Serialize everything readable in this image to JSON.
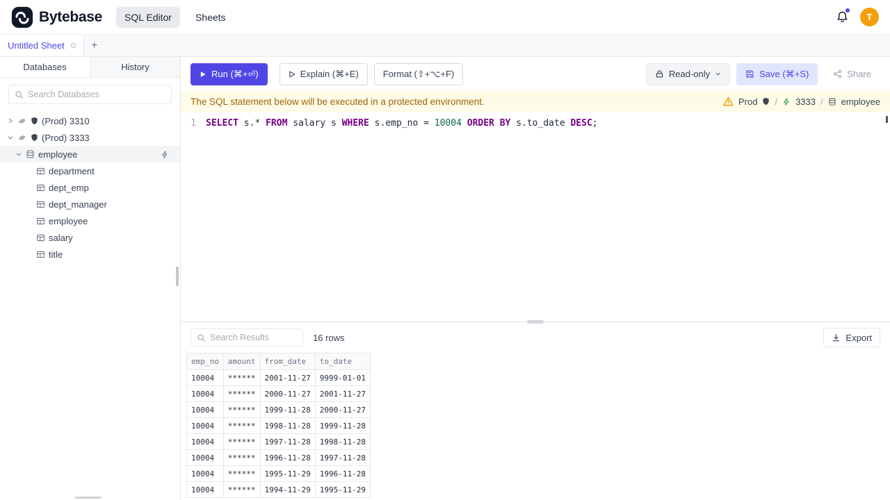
{
  "topbar": {
    "brand": "Bytebase",
    "nav": [
      {
        "label": "SQL Editor",
        "active": true
      },
      {
        "label": "Sheets",
        "active": false
      }
    ],
    "avatar_initial": "T"
  },
  "tabstrip": {
    "tabs": [
      {
        "label": "Untitled Sheet",
        "unsaved": true
      }
    ],
    "add_label": "+"
  },
  "sidebar": {
    "tabs": [
      {
        "label": "Databases",
        "active": true
      },
      {
        "label": "History",
        "active": false
      }
    ],
    "search_placeholder": "Search Databases",
    "tree": [
      {
        "label": "(Prod) 3310",
        "type": "instance",
        "depth": 0,
        "expanded": false,
        "selected": false
      },
      {
        "label": "(Prod) 3333",
        "type": "instance",
        "depth": 0,
        "expanded": true,
        "selected": false
      },
      {
        "label": "employee",
        "type": "database",
        "depth": 1,
        "expanded": true,
        "selected": true
      },
      {
        "label": "department",
        "type": "table",
        "depth": 2
      },
      {
        "label": "dept_emp",
        "type": "table",
        "depth": 2
      },
      {
        "label": "dept_manager",
        "type": "table",
        "depth": 2
      },
      {
        "label": "employee",
        "type": "table",
        "depth": 2
      },
      {
        "label": "salary",
        "type": "table",
        "depth": 2
      },
      {
        "label": "title",
        "type": "table",
        "depth": 2
      }
    ]
  },
  "toolbar": {
    "run_label": "Run (⌘+⏎)",
    "explain_label": "Explain (⌘+E)",
    "format_label": "Format (⇧+⌥+F)",
    "readonly_label": "Read-only",
    "save_label": "Save (⌘+S)",
    "share_label": "Share"
  },
  "banner": {
    "message": "The SQL statement below will be executed in a protected environment.",
    "environment": "Prod",
    "instance": "3333",
    "database": "employee",
    "separator": "/"
  },
  "editor": {
    "line_number": "1",
    "tokens": [
      {
        "text": "SELECT",
        "type": "keyword"
      },
      {
        "text": " s.",
        "type": "plain"
      },
      {
        "text": "*",
        "type": "operator"
      },
      {
        "text": " ",
        "type": "plain"
      },
      {
        "text": "FROM",
        "type": "keyword"
      },
      {
        "text": " salary s ",
        "type": "plain"
      },
      {
        "text": "WHERE",
        "type": "keyword"
      },
      {
        "text": " s.emp_no ",
        "type": "plain"
      },
      {
        "text": "=",
        "type": "operator"
      },
      {
        "text": " ",
        "type": "plain"
      },
      {
        "text": "10004",
        "type": "number"
      },
      {
        "text": " ",
        "type": "plain"
      },
      {
        "text": "ORDER",
        "type": "keyword"
      },
      {
        "text": " ",
        "type": "plain"
      },
      {
        "text": "BY",
        "type": "keyword"
      },
      {
        "text": " s.to_date ",
        "type": "plain"
      },
      {
        "text": "DESC",
        "type": "keyword"
      },
      {
        "text": ";",
        "type": "plain"
      }
    ]
  },
  "results": {
    "search_placeholder": "Search Results",
    "row_count": "16 rows",
    "export_label": "Export",
    "columns": [
      "emp_no",
      "amount",
      "from_date",
      "to_date"
    ],
    "rows": [
      [
        "10004",
        "******",
        "2001-11-27",
        "9999-01-01"
      ],
      [
        "10004",
        "******",
        "2000-11-27",
        "2001-11-27"
      ],
      [
        "10004",
        "******",
        "1999-11-28",
        "2000-11-27"
      ],
      [
        "10004",
        "******",
        "1998-11-28",
        "1999-11-28"
      ],
      [
        "10004",
        "******",
        "1997-11-28",
        "1998-11-28"
      ],
      [
        "10004",
        "******",
        "1996-11-28",
        "1997-11-28"
      ],
      [
        "10004",
        "******",
        "1995-11-29",
        "1996-11-28"
      ],
      [
        "10004",
        "******",
        "1994-11-29",
        "1995-11-29"
      ]
    ]
  },
  "colors": {
    "accent": "#4f46e5",
    "avatar_bg": "#f59e0b",
    "warning_banner_bg": "#fefce8",
    "warning_text": "#a16207",
    "warning_icon": "#f59e0b",
    "keyword": "#770088",
    "number": "#116644",
    "save_button_bg": "#e0e6fb"
  }
}
